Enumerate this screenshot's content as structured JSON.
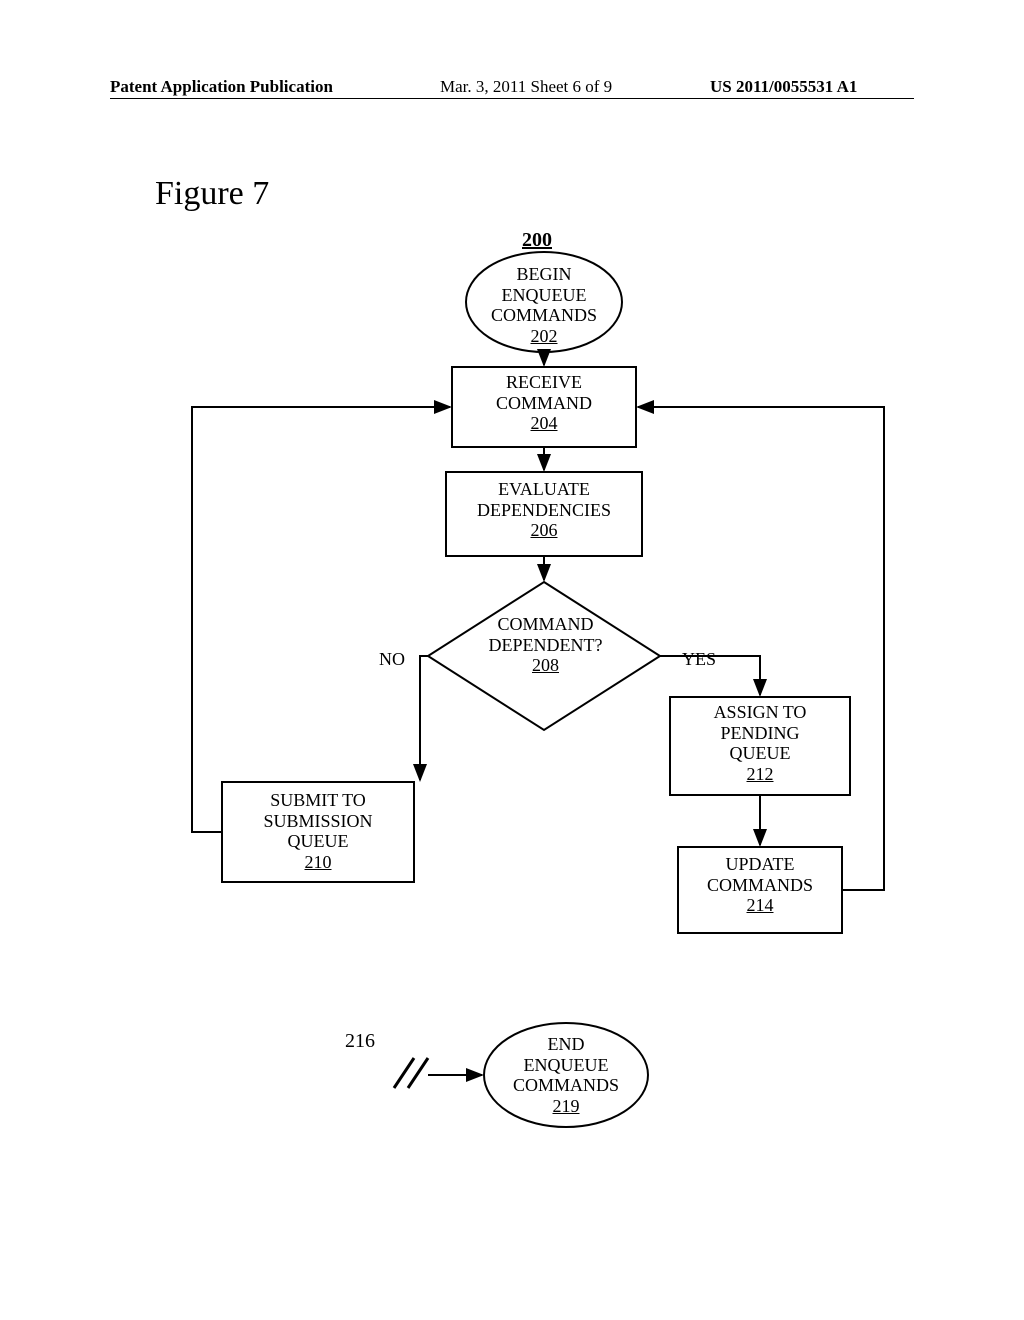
{
  "header": {
    "left": "Patent Application Publication",
    "center": "Mar. 3, 2011  Sheet 6 of 9",
    "right": "US 2011/0055531 A1"
  },
  "figure_title": "Figure 7",
  "ref_top": "200",
  "nodes": {
    "begin": {
      "label": "BEGIN\nENQUEUE\nCOMMANDS",
      "ref": "202"
    },
    "receive": {
      "label": "RECEIVE\nCOMMAND",
      "ref": "204"
    },
    "eval": {
      "label": "EVALUATE\nDEPENDENCIES",
      "ref": "206"
    },
    "decision": {
      "label": "COMMAND\nDEPENDENT?",
      "ref": "208"
    },
    "no_label": "NO",
    "yes_label": "YES",
    "assign": {
      "label": "ASSIGN TO\nPENDING\nQUEUE",
      "ref": "212"
    },
    "submit": {
      "label": "SUBMIT TO\nSUBMISSION\nQUEUE",
      "ref": "210"
    },
    "update": {
      "label": "UPDATE\nCOMMANDS",
      "ref": "214"
    },
    "end": {
      "label": "END\nENQUEUE\nCOMMANDS",
      "ref": "219"
    },
    "ref216": "216"
  }
}
